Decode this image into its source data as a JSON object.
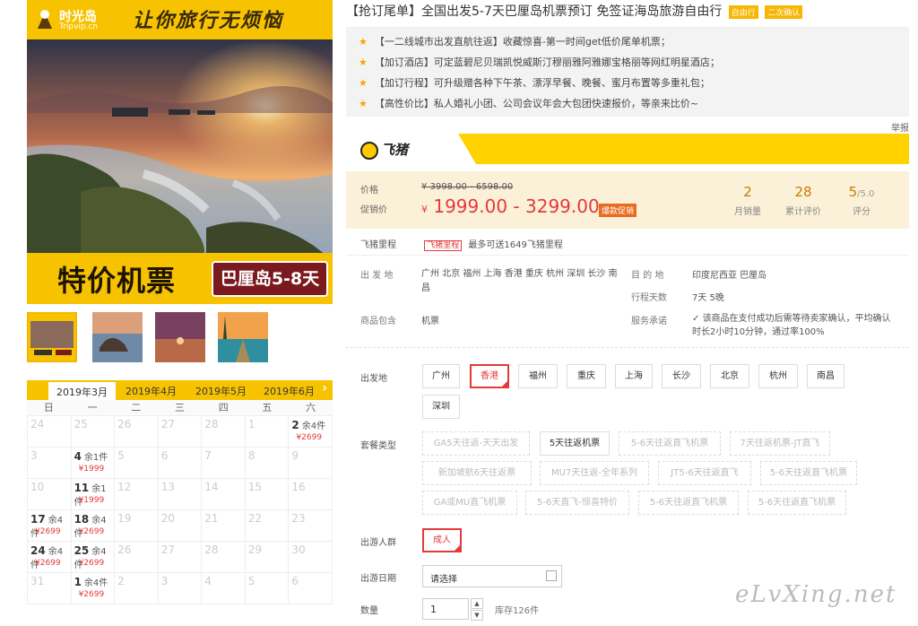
{
  "hero": {
    "brand_name": "时光岛",
    "brand_url": "Tripvip.cn",
    "slogan": "让你旅行无烦恼",
    "promo": "特价机票",
    "destination_tag": "巴厘岛5-8天"
  },
  "calendar": {
    "months": [
      "2019年3月",
      "2019年4月",
      "2019年5月",
      "2019年6月"
    ],
    "active_month": 0,
    "weekdays": [
      "日",
      "一",
      "二",
      "三",
      "四",
      "五",
      "六"
    ],
    "cells": [
      {
        "d": "24"
      },
      {
        "d": "25"
      },
      {
        "d": "26"
      },
      {
        "d": "27"
      },
      {
        "d": "28"
      },
      {
        "d": "1"
      },
      {
        "d": "2",
        "rest": "余4件",
        "price": "¥2699"
      },
      {
        "d": "3"
      },
      {
        "d": "4",
        "rest": "余1件",
        "price": "¥1999"
      },
      {
        "d": "5"
      },
      {
        "d": "6"
      },
      {
        "d": "7"
      },
      {
        "d": "8"
      },
      {
        "d": "9"
      },
      {
        "d": "10"
      },
      {
        "d": "11",
        "rest": "余1件",
        "price": "¥1999"
      },
      {
        "d": "12"
      },
      {
        "d": "13"
      },
      {
        "d": "14"
      },
      {
        "d": "15"
      },
      {
        "d": "16"
      },
      {
        "d": "17",
        "rest": "余4件",
        "price": "¥2699"
      },
      {
        "d": "18",
        "rest": "余4件",
        "price": "¥2699"
      },
      {
        "d": "19"
      },
      {
        "d": "20"
      },
      {
        "d": "21"
      },
      {
        "d": "22"
      },
      {
        "d": "23"
      },
      {
        "d": "24",
        "rest": "余4件",
        "price": "¥2699"
      },
      {
        "d": "25",
        "rest": "余4件",
        "price": "¥2699"
      },
      {
        "d": "26"
      },
      {
        "d": "27"
      },
      {
        "d": "28"
      },
      {
        "d": "29"
      },
      {
        "d": "30"
      },
      {
        "d": "31"
      },
      {
        "d": "1",
        "rest": "余4件",
        "price": "¥2699"
      },
      {
        "d": "2"
      },
      {
        "d": "3"
      },
      {
        "d": "4"
      },
      {
        "d": "5"
      },
      {
        "d": "6"
      }
    ]
  },
  "product": {
    "title": "【抢订尾单】全国出发5-7天巴厘岛机票预订 免签证海岛旅游自由行",
    "badges": [
      "自由行",
      "二次确认"
    ],
    "features": [
      "【一二线城市出发直航往返】收藏惊喜-第一时间get低价尾单机票；",
      "【加订酒店】可定蓝碧尼贝瑞凯悦威斯汀穆丽雅阿雅娜宝格丽等网红明星酒店；",
      "【加订行程】可升级赠各种下午茶、漂浮早餐、晚餐、蜜月布置等多重礼包；",
      "【高性价比】私人婚礼小团、公司会议年会大包团快速报价，等亲来比价~"
    ],
    "report": "举报",
    "platform": "飞猪"
  },
  "price": {
    "orig_label": "价格",
    "orig": "¥ 3998.00 - 6598.00",
    "sale_label": "促销价",
    "sale_currency": "¥",
    "sale": "1999.00 - 3299.00",
    "hot_tag": "爆款促销",
    "stats": [
      {
        "value": "2",
        "suffix": "",
        "label": "月销量"
      },
      {
        "value": "28",
        "suffix": "",
        "label": "累计评价"
      },
      {
        "value": "5",
        "suffix": "/5.0",
        "label": "评分"
      }
    ]
  },
  "miles": {
    "label": "飞猪里程",
    "tag": "飞猪里程",
    "text": "最多可送1649飞猪里程"
  },
  "info": {
    "depart_label": "出 发 地",
    "depart_value": "广州 北京 福州 上海 香港 重庆 杭州 深圳 长沙 南昌",
    "dest_label": "目 的 地",
    "dest_value": "印度尼西亚 巴厘岛",
    "days_label": "行程天数",
    "days_value": "7天 5晚",
    "include_label": "商品包含",
    "include_value": "机票",
    "promise_label": "服务承诺",
    "promise_value": "该商品在支付成功后需等待卖家确认，平均确认时长2小时10分钟，通过率100%"
  },
  "options": {
    "depart_label": "出发地",
    "depart": [
      "广州",
      "香港",
      "福州",
      "重庆",
      "上海",
      "长沙",
      "北京",
      "杭州",
      "南昌",
      "深圳"
    ],
    "package_label": "套餐类型",
    "packages": [
      "GA5天往返-天天出发",
      "5天往返机票",
      "5-6天往返直飞机票",
      "7天往返机票-JT直飞",
      "新加坡航6天往返票",
      "MU7天往返-全年系列",
      "JT5-6天往返直飞",
      "5-6天往返直飞机票",
      "GA或MU直飞机票",
      "5-6天直飞-惊喜特价",
      "5-6天往返直飞机票",
      "5-6天往返直飞机票"
    ],
    "crowd_label": "出游人群",
    "crowd": [
      "成人"
    ],
    "date_label": "出游日期",
    "date_placeholder": "请选择",
    "qty_label": "数量",
    "qty_value": "1",
    "stock": "库存126件"
  },
  "watermark": "eLvXing.net"
}
